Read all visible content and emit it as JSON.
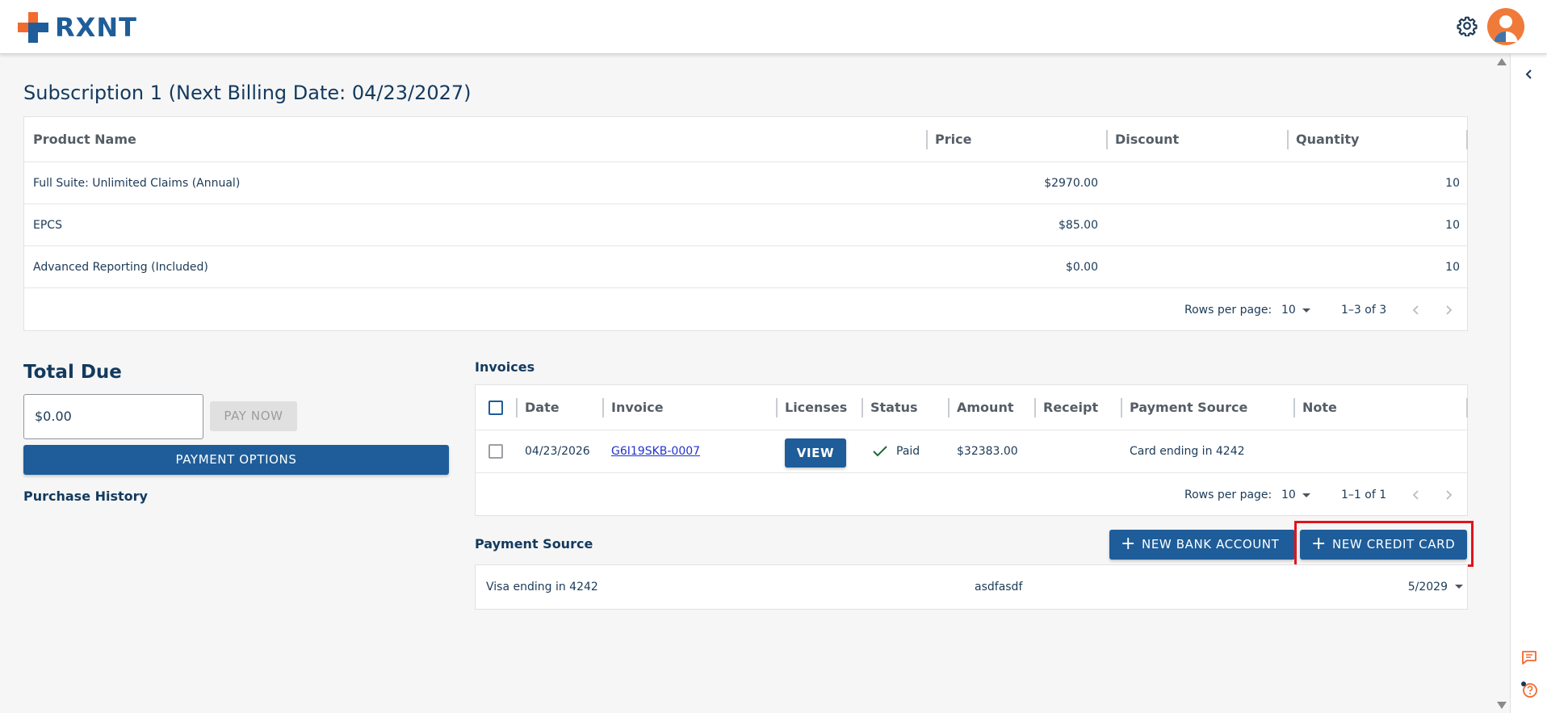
{
  "header": {
    "logo_text": "RXNT"
  },
  "subscription": {
    "title": "Subscription 1 (Next Billing Date: 04/23/2027)",
    "columns": [
      "Product Name",
      "Price",
      "Discount",
      "Quantity"
    ],
    "rows": [
      {
        "product": "Full Suite: Unlimited Claims (Annual)",
        "price": "$2970.00",
        "discount": "",
        "quantity": "10"
      },
      {
        "product": "EPCS",
        "price": "$85.00",
        "discount": "",
        "quantity": "10"
      },
      {
        "product": "Advanced Reporting (Included)",
        "price": "$0.00",
        "discount": "",
        "quantity": "10"
      }
    ],
    "pager": {
      "rows_label": "Rows per page:",
      "rows_value": "10",
      "range": "1–3 of 3"
    }
  },
  "total_due": {
    "title": "Total Due",
    "amount": "$0.00",
    "pay_now": "PAY NOW",
    "payment_options": "PAYMENT OPTIONS",
    "purchase_history": "Purchase History"
  },
  "invoices": {
    "title": "Invoices",
    "columns": [
      "Date",
      "Invoice",
      "Licenses",
      "Status",
      "Amount",
      "Receipt",
      "Payment Source",
      "Note"
    ],
    "rows": [
      {
        "date": "04/23/2026",
        "invoice": "G6I19SKB-0007",
        "licenses_button": "VIEW",
        "status": "Paid",
        "amount": "$32383.00",
        "receipt": "",
        "payment_source": "Card ending in 4242",
        "note": ""
      }
    ],
    "pager": {
      "rows_label": "Rows per page:",
      "rows_value": "10",
      "range": "1–1 of 1"
    }
  },
  "payment_source": {
    "title": "Payment Source",
    "new_bank_account": "NEW BANK ACCOUNT",
    "new_credit_card": "NEW CREDIT CARD",
    "source": {
      "card": "Visa ending in 4242",
      "name": "asdfasdf",
      "expiry": "5/2029"
    }
  },
  "colors": {
    "brand_blue": "#1e5d99",
    "brand_orange": "#f26a2e",
    "highlight_red": "#e0151b"
  }
}
